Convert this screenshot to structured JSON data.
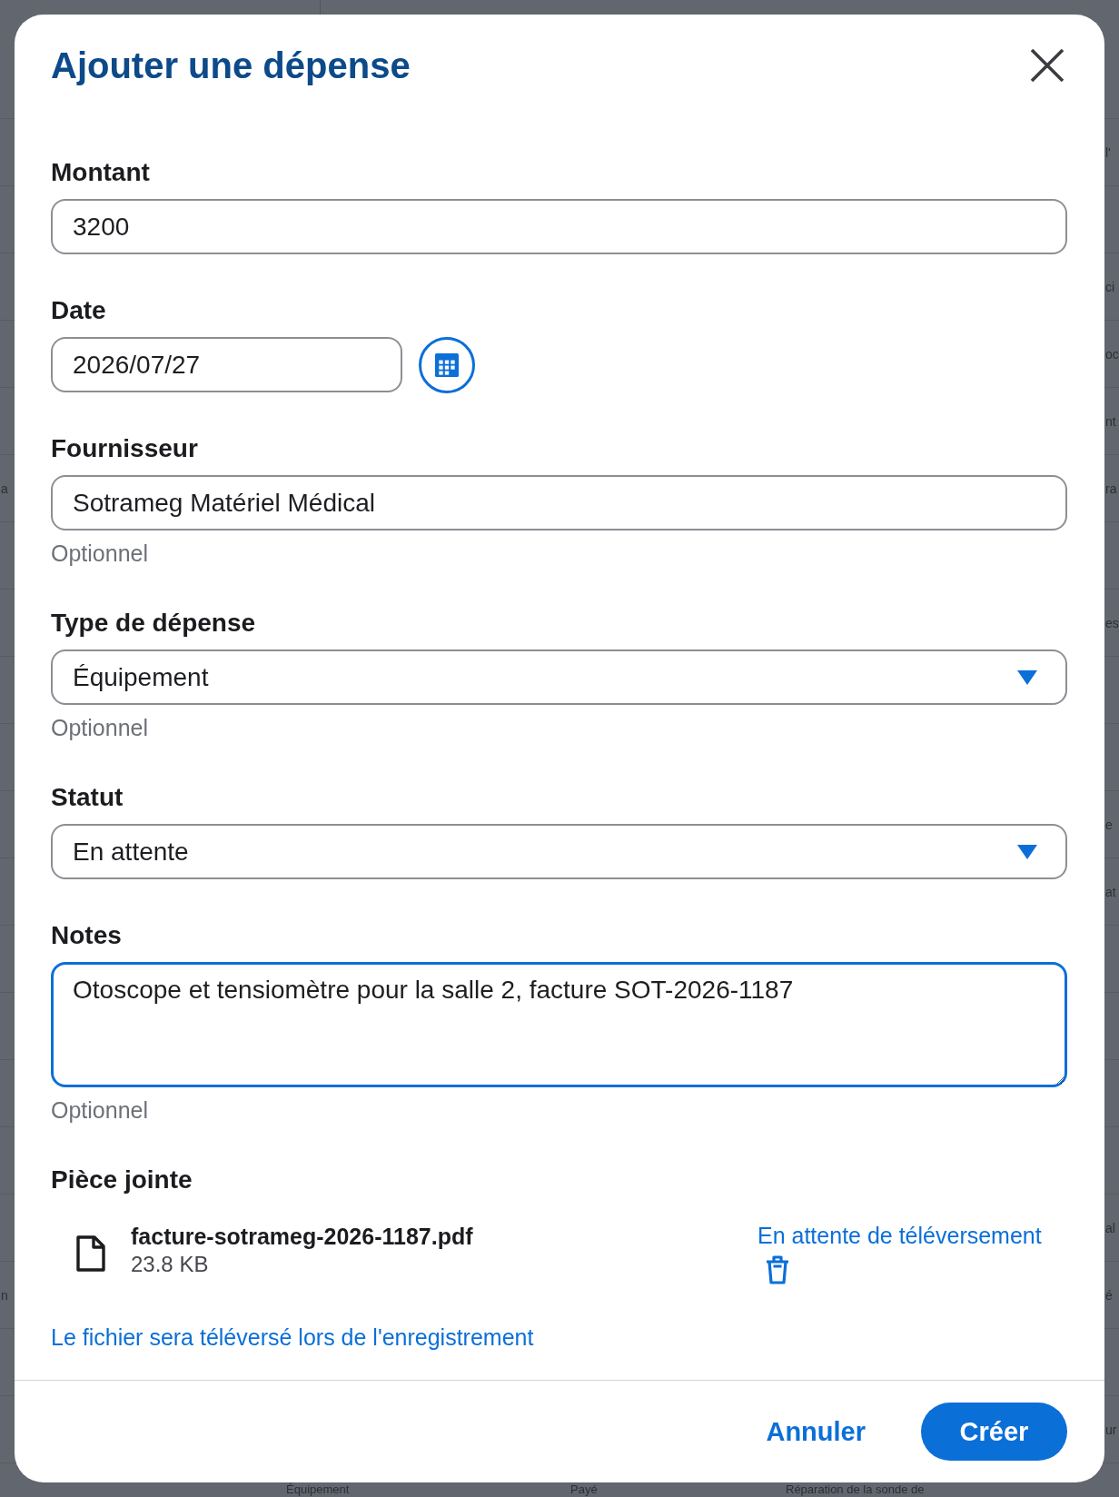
{
  "background": {
    "left_edge": [
      "a",
      "n"
    ],
    "right_edge": [
      "l'",
      "ci",
      "oc",
      "nt",
      "ra",
      "es",
      "e",
      "at",
      "al",
      "é",
      "ur"
    ],
    "bottom_row": [
      "Équipement",
      "Payé",
      "Réparation de la sonde de"
    ]
  },
  "dialog": {
    "title": "Ajouter une dépense",
    "fields": [
      {
        "kind": "text",
        "label": "Montant",
        "value": "3200",
        "focused": false
      },
      {
        "kind": "date",
        "label": "Date",
        "value": "2026/07/27",
        "focused": false
      },
      {
        "kind": "text",
        "label": "Fournisseur",
        "value": "Sotrameg Matériel Médical",
        "hint": "Optionnel",
        "focused": false
      },
      {
        "kind": "select",
        "label": "Type de dépense",
        "value": "Équipement",
        "hint": "Optionnel",
        "focused": false
      },
      {
        "kind": "select",
        "label": "Statut",
        "value": "En attente",
        "focused": false
      },
      {
        "kind": "textarea",
        "label": "Notes",
        "value": "Otoscope et tensiomètre pour la salle 2, facture SOT-2026-1187",
        "hint": "Optionnel",
        "focused": true
      }
    ],
    "attachment": {
      "label": "Pièce jointe",
      "file_name": "facture-sotrameg-2026-1187.pdf",
      "file_size": "23.8 KB",
      "status": "En attente de téléversement",
      "note": "Le fichier sera téléversé lors de l'enregistrement"
    },
    "buttons": [
      {
        "kind": "text",
        "label": "Annuler"
      },
      {
        "kind": "primary",
        "label": "Créer"
      }
    ]
  }
}
